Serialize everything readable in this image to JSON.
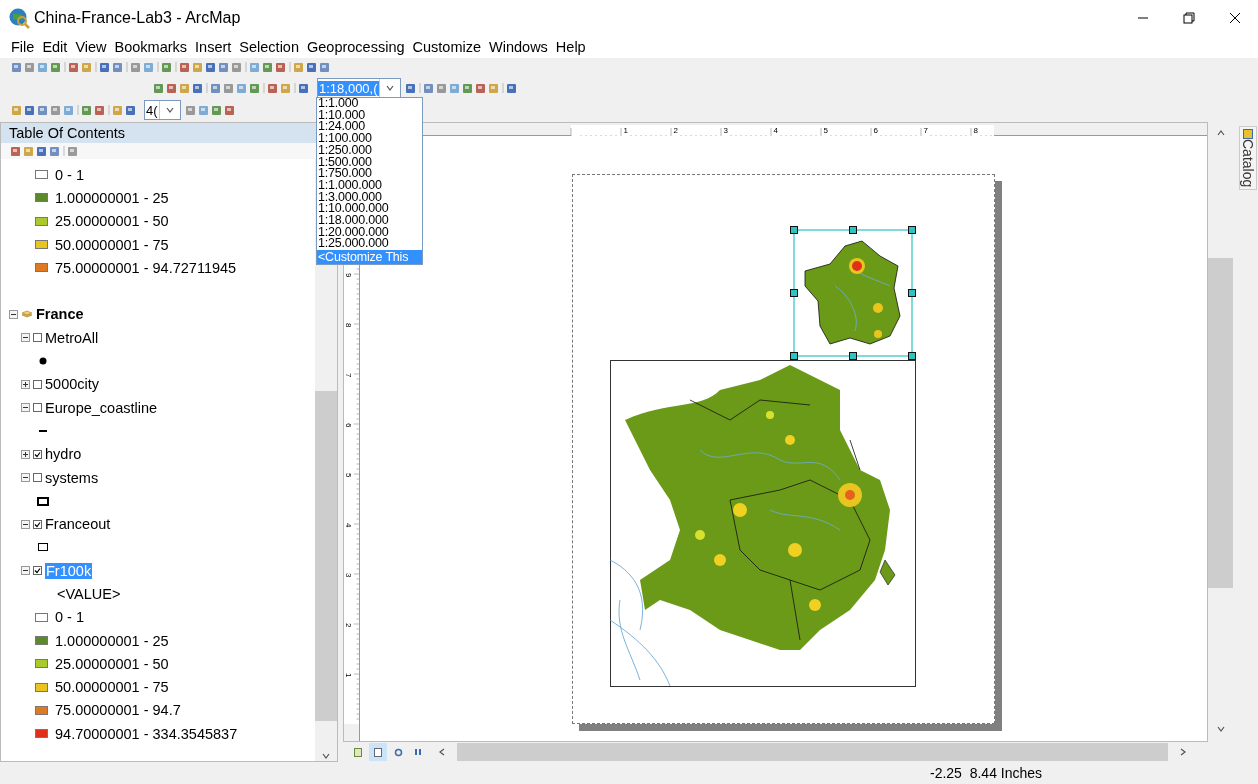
{
  "window": {
    "title": "China-France-Lab3 - ArcMap"
  },
  "menu": [
    "File",
    "Edit",
    "View",
    "Bookmarks",
    "Insert",
    "Selection",
    "Geoprocessing",
    "Customize",
    "Windows",
    "Help"
  ],
  "toolbar": {
    "scale": "1:18,000,(",
    "zoom": "4("
  },
  "scale_dropdown": {
    "options": [
      {
        "label": "1:1.000",
        "selected": false
      },
      {
        "label": "1:10.000",
        "selected": false
      },
      {
        "label": "1:24.000",
        "selected": false
      },
      {
        "label": "1:100.000",
        "selected": false
      },
      {
        "label": "1:250.000",
        "selected": false
      },
      {
        "label": "1:500.000",
        "selected": false
      },
      {
        "label": "1:750.000",
        "selected": false
      },
      {
        "label": "1:1.000.000",
        "selected": false
      },
      {
        "label": "1:3.000.000",
        "selected": false
      },
      {
        "label": "1:10.000.000",
        "selected": false
      },
      {
        "label": "1:18.000.000",
        "selected": false
      },
      {
        "label": "1:20.000.000",
        "selected": false
      },
      {
        "label": "1:25.000.000",
        "selected": false
      },
      {
        "label": "<Customize This",
        "selected": true
      }
    ]
  },
  "toc": {
    "title": "Table Of Contents",
    "items": [
      {
        "kind": "legend",
        "label": "0 - 1",
        "color": "#ffffff"
      },
      {
        "kind": "legend",
        "label": "1.000000001 - 25",
        "color": "#5b8a2b"
      },
      {
        "kind": "legend",
        "label": "25.00000001 - 50",
        "color": "#a9c92c"
      },
      {
        "kind": "legend",
        "label": "50.00000001 - 75",
        "color": "#e8c51f"
      },
      {
        "kind": "legend",
        "label": "75.00000001 - 94.72711945",
        "color": "#e07a22"
      },
      {
        "kind": "group",
        "label": "France",
        "expanded": true,
        "children": [
          {
            "kind": "layer",
            "label": "MetroAll",
            "expanded": true,
            "checked": false,
            "selected": false,
            "children": [
              {
                "kind": "point-symbol"
              }
            ]
          },
          {
            "kind": "layer",
            "label": "5000city",
            "expanded": false,
            "checked": false,
            "selected": false
          },
          {
            "kind": "layer",
            "label": "Europe_coastline",
            "expanded": true,
            "checked": false,
            "selected": false,
            "children": [
              {
                "kind": "line-symbol"
              }
            ]
          },
          {
            "kind": "layer",
            "label": "hydro",
            "expanded": false,
            "checked": true,
            "selected": false
          },
          {
            "kind": "layer",
            "label": "systems",
            "expanded": true,
            "checked": false,
            "selected": false,
            "children": [
              {
                "kind": "bold-box-symbol"
              }
            ]
          },
          {
            "kind": "layer",
            "label": "Franceout",
            "expanded": true,
            "checked": true,
            "selected": false,
            "children": [
              {
                "kind": "hollow-box-symbol"
              }
            ]
          },
          {
            "kind": "layer",
            "label": "Fr100k",
            "expanded": true,
            "checked": true,
            "selected": true,
            "children": [
              {
                "kind": "heading",
                "label": "<VALUE>"
              },
              {
                "kind": "legend",
                "label": "0 - 1",
                "color": "#ffffff"
              },
              {
                "kind": "legend",
                "label": "1.000000001 - 25",
                "color": "#5b8a2b"
              },
              {
                "kind": "legend",
                "label": "25.00000001 - 50",
                "color": "#a9c92c"
              },
              {
                "kind": "legend",
                "label": "50.00000001 - 75",
                "color": "#e8c51f"
              },
              {
                "kind": "legend",
                "label": "75.00000001 - 94.7",
                "color": "#e07a22"
              },
              {
                "kind": "legend",
                "label": "94.70000001 - 334.3545837",
                "color": "#e0301a"
              }
            ]
          }
        ]
      }
    ]
  },
  "rulers": {
    "horizontal": [
      "1",
      "2",
      "3",
      "4",
      "5",
      "6",
      "7",
      "8"
    ],
    "vertical": [
      "9",
      "8",
      "7",
      "6",
      "5",
      "4",
      "3",
      "2",
      "1"
    ]
  },
  "catalog_tab": "Catalog",
  "status_bar": {
    "coordinates": "-2.25  8.44 Inches"
  }
}
